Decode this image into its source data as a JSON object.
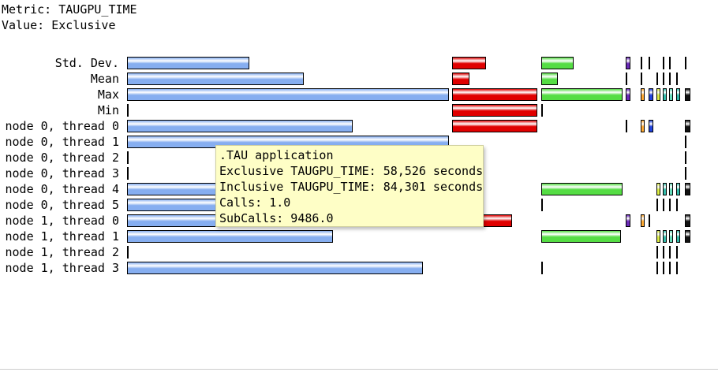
{
  "header": {
    "metric_line": "Metric: TAUGPU_TIME",
    "value_line": "Value: Exclusive"
  },
  "rows": [
    "Std. Dev.",
    "Mean",
    "Max",
    "Min",
    "node 0, thread 0",
    "node 0, thread 1",
    "node 0, thread 2",
    "node 0, thread 3",
    "node 0, thread 4",
    "node 0, thread 5",
    "node 1, thread 0",
    "node 1, thread 1",
    "node 1, thread 2",
    "node 1, thread 3"
  ],
  "colors": {
    "blue": "#86aef0",
    "red": "#e00000",
    "green": "#55dd44",
    "purple": "#6a2ab8",
    "orange": "#ffaa33",
    "navy": "#2244dd",
    "lime": "#ddee44",
    "teal": "#33bbaa",
    "mint": "#66ddbb",
    "black": "#111111"
  },
  "bars": {
    "application": [
      0.38,
      0.55,
      1.0,
      0.0,
      0.7,
      1.0,
      0.0,
      0.0,
      0.7,
      0.92,
      0.88,
      0.64,
      0.0,
      0.92
    ],
    "red": [
      0.4,
      0.2,
      1.0,
      1.0,
      1.0,
      null,
      null,
      null,
      null,
      null,
      0.7,
      null,
      null,
      null
    ],
    "green": [
      0.4,
      0.2,
      1.0,
      0.0,
      null,
      null,
      null,
      null,
      1.0,
      0.0,
      null,
      0.98,
      null,
      0.0
    ]
  },
  "tooltip": {
    "title": ".TAU application",
    "exclusive": "Exclusive TAUGPU_TIME: 58,526 seconds",
    "inclusive": "Inclusive TAUGPU_TIME: 84,301 seconds",
    "calls": "Calls: 1.0",
    "subcalls": "SubCalls: 9486.0"
  }
}
